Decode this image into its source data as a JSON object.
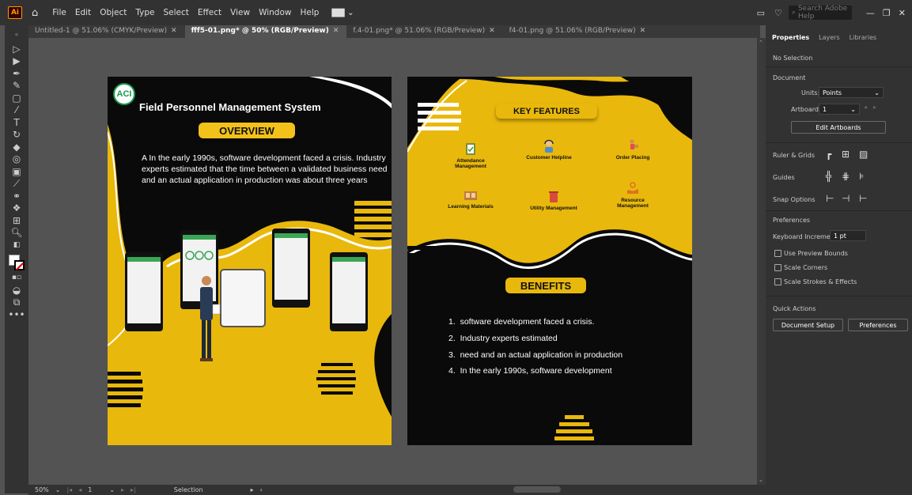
{
  "app": {
    "logo": "Ai",
    "menus": [
      "File",
      "Edit",
      "Object",
      "Type",
      "Select",
      "Effect",
      "View",
      "Window",
      "Help"
    ],
    "search_placeholder": "Search Adobe Help"
  },
  "tabs": [
    {
      "label": "Untitled-1 @ 51.06% (CMYK/Preview)",
      "active": false
    },
    {
      "label": "fff5-01.png* @ 50% (RGB/Preview)",
      "active": true
    },
    {
      "label": "f.4-01.png* @ 51.06% (RGB/Preview)",
      "active": false
    },
    {
      "label": "f4-01.png @ 51.06% (RGB/Preview)",
      "active": false
    }
  ],
  "status": {
    "zoom": "50%",
    "artboard": "1",
    "tool": "Selection"
  },
  "panel": {
    "tabs": [
      "Properties",
      "Layers",
      "Libraries"
    ],
    "no_selection": "No Selection",
    "document": "Document",
    "units_label": "Units:",
    "units_value": "Points",
    "artboard_label": "Artboard:",
    "artboard_value": "1",
    "edit_artboards": "Edit Artboards",
    "ruler_grids": "Ruler & Grids",
    "guides": "Guides",
    "snap_options": "Snap Options",
    "preferences": "Preferences",
    "keyboard_increment_label": "Keyboard Increment:",
    "keyboard_increment_value": "1 pt",
    "use_preview_bounds": "Use Preview Bounds",
    "scale_corners": "Scale Corners",
    "scale_strokes": "Scale Strokes & Effects",
    "quick_actions": "Quick Actions",
    "document_setup": "Document Setup",
    "preferences_btn": "Preferences"
  },
  "artboard1": {
    "logo": "ACI",
    "title": "Field Personnel Management System",
    "overview": "OVERVIEW",
    "paragraph": "A In the early 1990s, software development faced a crisis. Industry experts estimated that the time between a validated business need and an actual application in production was about three years"
  },
  "artboard2": {
    "key_features": "KEY FEATURES",
    "features": [
      {
        "label": "Attendance Management",
        "icon": "clipboard-check-icon"
      },
      {
        "label": "Customer Helpline",
        "icon": "support-agent-icon"
      },
      {
        "label": "Order Placing",
        "icon": "delivery-person-icon"
      },
      {
        "label": "Learning Materials",
        "icon": "books-icon"
      },
      {
        "label": "Utility Management",
        "icon": "utility-bin-icon"
      },
      {
        "label": "Resource Management",
        "icon": "resource-hand-icon"
      }
    ],
    "benefits": "BENEFITS",
    "benefit_items": [
      "1.  software development faced a crisis.",
      "2.  Industry experts estimated",
      "3.  need and an actual application in production",
      "4.  In the early 1990s, software development"
    ]
  }
}
